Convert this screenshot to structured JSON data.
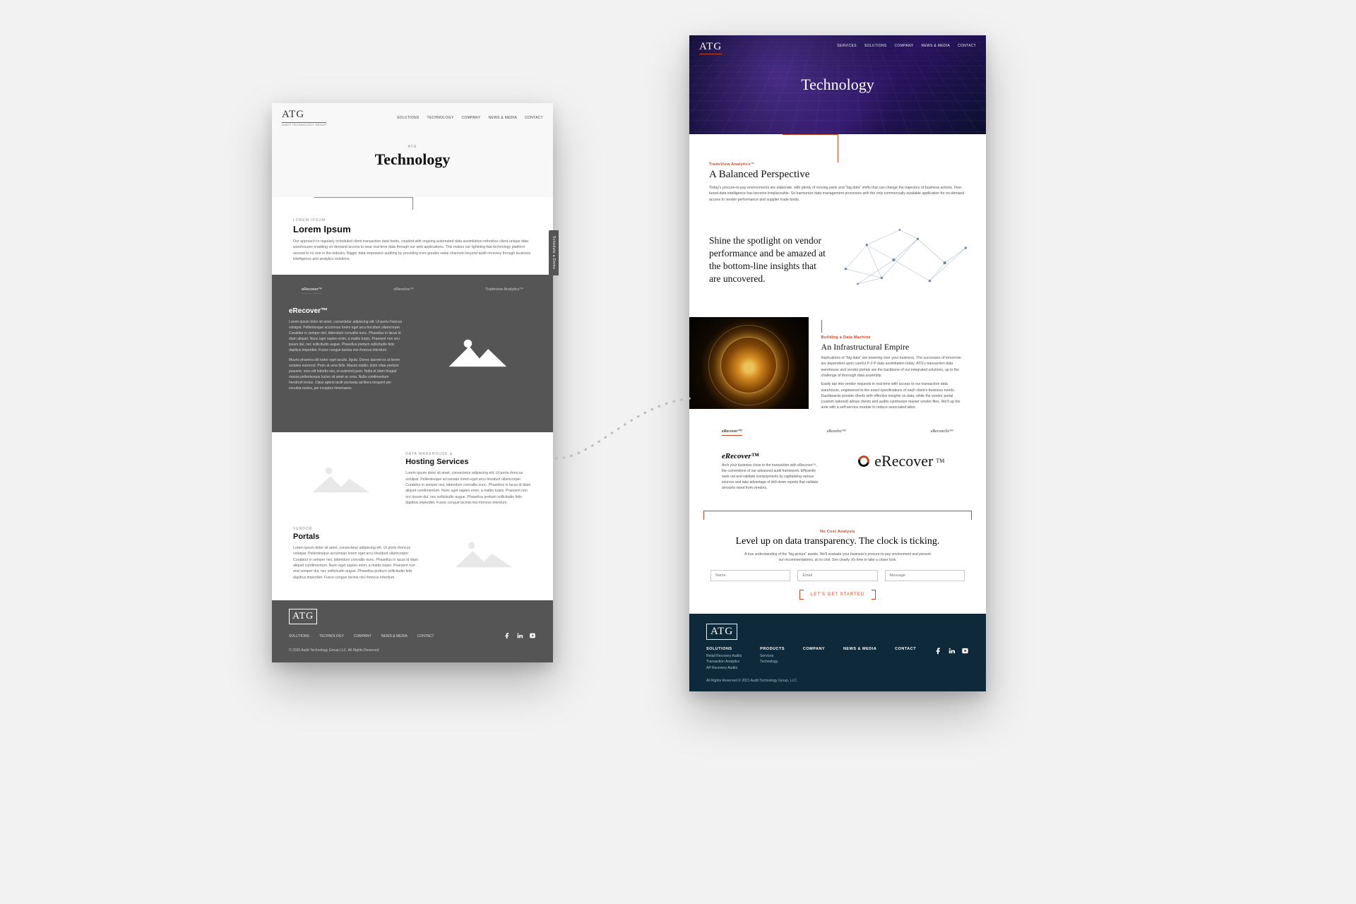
{
  "left": {
    "logo": "ATG",
    "logo_sub": "AUDIT TECHNOLOGY GROUP",
    "nav": [
      "SOLUTIONS",
      "TECHNOLOGY",
      "COMPANY",
      "NEWS & MEDIA",
      "CONTACT"
    ],
    "schedule_label": "Schedule a Demo",
    "hero_eyebrow": "ATG",
    "hero_title": "Technology",
    "s1_eyebrow": "LOREM IPSUM",
    "s1_title": "Lorem Ipsum",
    "s1_body": "Our approach to regularly scheduled client transaction data feeds, coupled with ongoing automated data assimilation refreshes client-unique data warehouses enabling on-demand access to near real-time data through our web applications. This makes our lightning fast technology platform second to no one in the industry. Bigger data empowers auditing by providing ever-greater value channels beyond audit recovery through business intelligence and analytics solutions.",
    "tabs": [
      "eRecover™",
      "eResolve™",
      "Tradeview Analytics™"
    ],
    "dark_title": "eRecover™",
    "dark_p1": "Lorem ipsum dolor sit amet, consectetur adipiscing elit. Ut porta rhoncus volutpat. Pellentesque accumsan lorem eget arcu tincidunt ullamcorper. Curabitur in semper nisl, bibendum convallis nunc. Phasellus in lacus id diam aliquet. Nunc eget sapien enim, a mattis turpis. Praesent non orci ipsum dui, nec sollicitudin augue. Phasellus pretium sollicitudin felis dapibus imperdiet. Fusce congue lacinia nisi rhoncus interdum.",
    "dark_p2": "Mauris pharetra elit tortor eget iaculis. Ilgula. Donec laoreet ex at lorem sodales euismod. Proin at urna felis. Mauris mattis, dolor vitae pretium posuere, eros elit lobortis nisi, et euismod justo. Nulla et diam feugiat massa pellentesque luctus sit amet ac urna. Nulla condimentum hendrerit lectus. Class aptent taciti sociosqu ad litora torquent per conubia nostra, per inceptos himenaeos.",
    "s2_eyebrow": "DATA WAREHOUSE &",
    "s2_title": "Hosting Services",
    "s2_body": "Lorem ipsum dolor sit amet, consectetur adipiscing elit. Ut porta rhoncus volutpat. Pellentesque accumsan lorem eget arcu tincidunt ullamcorper. Curabitur in semper nisl, bibendum convallis nunc. Phasellus in lacus id diam aliquet condimentum. Nunc eget sapien enim, a mattis turpis. Praesent non orci ipsum dui, nec sollicitudin augue. Phasellus pretium sollicitudin felis dapibus imperdiet. Fusce congue lacinia nisi rhoncus interdum.",
    "s3_eyebrow": "VENDOR",
    "s3_title": "Portals",
    "s3_body": "Lorem ipsum dolor sit amet, consectetur adipiscing elit. Ut porta rhoncus volutpat. Pellentesque accumsan lorem eget arcu tincidunt ullamcorper. Curabitur in semper nisl, bibendum convallis nunc. Phasellus in lacus id diam aliquet condimentum. Nunc eget sapien enim, a mattis turpis. Praesent non erat semper dui, nec sollicitudin augue. Phasellus pretium sollicitudin felis dapibus imperdiet. Fusce congue lacinia nisi rhoncus interdum.",
    "footer_nav": [
      "SOLUTIONS",
      "TECHNOLOGY",
      "COMPANY",
      "NEWS & MEDIA",
      "CONTACT"
    ],
    "copyright": "© 2020  Audit Technology Group LLC. All Rights Reserved"
  },
  "right": {
    "logo": "ATG",
    "nav": [
      "SERVICES",
      "SOLUTIONS",
      "COMPANY",
      "NEWS & MEDIA",
      "CONTACT"
    ],
    "hero_title": "Technology",
    "s1_eyebrow": "TradeView Analytics™",
    "s1_title": "A Balanced Perspective",
    "s1_body": "Today's procure-to-pay environments are elaborate, with plenty of moving parts and \"big data\" shifts that can change the trajectory of business actions. Fine-tuned data intelligence has become irreplaceable. So harmonize data management processes with the only commercially available application for on-demand access to vendor performance and supplier trade funds.",
    "spotlight": "Shine the spotlight on vendor performance and be amazed at the bottom-line insights that are uncovered.",
    "dm_eyebrow": "Building a Data Machine",
    "dm_title": "An Infrastructural Empire",
    "dm_p1": "Implications of \"big data\" are towering over your business. The successes of tomorrow are dependent upon careful P-2-P data assimilation today. ATG's transaction data warehouse and vendor portals are the backbone of our integrated solutions, up to the challenge of thorough data assembly.",
    "dm_p2": "Easily tap into vendor requests in real-time with access to our transaction data warehouse, engineered to the exact specifications of each client's business needs. Dashboards provide clients with effective insights on data, while the vendor portal (custom tailored) allows clients and audits synthesize master vendor files. We'll up the ante with a self-service module to reduce associated labor.",
    "tabs": [
      "eRecover™",
      "eResolve™",
      "eReconcile™"
    ],
    "brand_title": "eRecover™",
    "brand_body": "Arch your business close to the transaction with eRecover™, the cornerstone of our advanced audit framework. Efficiently seek out and validate overpayments by capitalizing various sources and take advantage of drill-down reports that validate amounts owed from vendors.",
    "brand_logo": "eRecover",
    "brand_logo_tm": "TM",
    "cta_eyebrow": "No Cost Analysis",
    "cta_title": "Level up on data transparency. The clock is ticking.",
    "cta_body": "A true understanding of the \"big picture\" awaits. We'll evaluate your business's procure-to-pay environment and present our recommendations, at no cost. See clearly. It's time to take a closer look.",
    "form": {
      "name_ph": "Name",
      "email_ph": "Email",
      "msg_ph": "Message"
    },
    "cta_button": "LET'S GET STARTED",
    "footer": {
      "cols": [
        {
          "h": "SOLUTIONS",
          "items": [
            "Retail Recovery Audits",
            "Transaction Analytics",
            "AP Recovery Audits"
          ]
        },
        {
          "h": "PRODUCTS",
          "items": [
            "Services",
            "Technology"
          ]
        },
        {
          "h": "COMPANY",
          "items": []
        },
        {
          "h": "NEWS & MEDIA",
          "items": []
        },
        {
          "h": "CONTACT",
          "items": []
        }
      ],
      "copyright": "All Rights Reserved © 2021 Audit Technology Group, LLC."
    }
  }
}
